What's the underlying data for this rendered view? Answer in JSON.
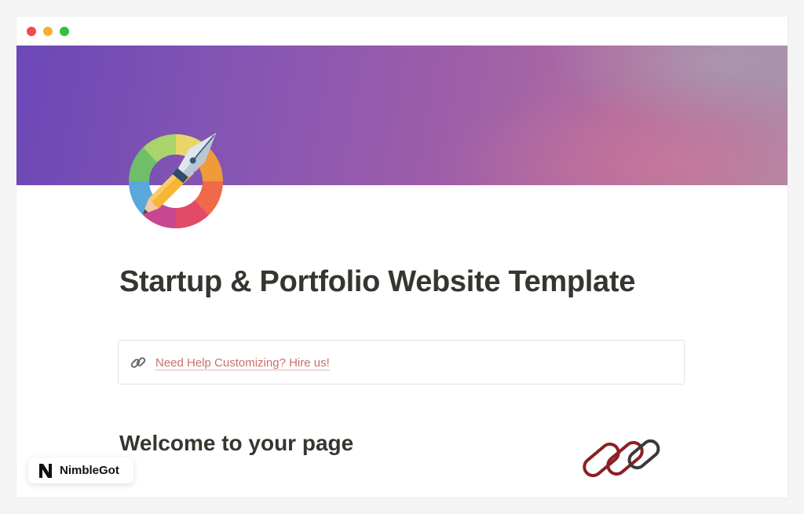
{
  "window": {
    "controls": [
      "close",
      "minimize",
      "maximize"
    ]
  },
  "cover": {
    "gradient_colors": [
      "#6c47b6",
      "#9d5da9",
      "#b06d9f",
      "#a98ba8"
    ]
  },
  "page": {
    "icon": "pen-and-palette-icon",
    "title": "Startup & Portfolio Website Template",
    "callout": {
      "icon": "link-icon",
      "link_text": "Need Help Customizing? Hire us!",
      "link_color": "#c9706a"
    },
    "section_heading": "Welcome to your page",
    "section_graphic": "chain-links-icon"
  },
  "brand": {
    "name": "NimbleGot",
    "logo_letter": "N"
  }
}
